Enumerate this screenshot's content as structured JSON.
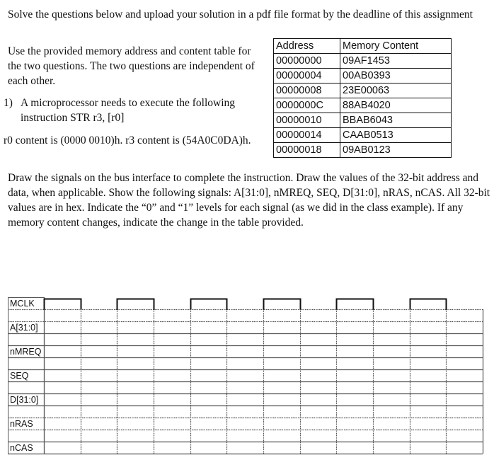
{
  "intro": "Solve the questions below and upload your solution in a pdf file format by the deadline of this assignment",
  "shared_note": "Use the provided memory address and content table for the two questions. The two questions are independent of each other.",
  "question1": {
    "number": "1)",
    "text": "A microprocessor needs to execute the following instruction STR  r3, [r0]"
  },
  "registers": "r0 content is (0000 0010)h. r3 content is (54A0C0DA)h.",
  "instructions": "Draw the signals on the bus interface to complete the instruction. Draw the values of the 32-bit address and data, when applicable. Show the following signals: A[31:0], nMREQ, SEQ, D[31:0], nRAS, nCAS. All 32-bit values are in hex. Indicate the “0” and “1” levels for each signal (as we did in the class example). If any memory content changes, indicate the change in the table provided.",
  "memory_table": {
    "headers": [
      "Address",
      "Memory Content"
    ],
    "rows": [
      [
        "00000000",
        "09AF1453"
      ],
      [
        "00000004",
        "00AB0393"
      ],
      [
        "00000008",
        "23E00063"
      ],
      [
        "0000000C",
        "88AB4020"
      ],
      [
        "00000010",
        "BBAB6043"
      ],
      [
        "00000014",
        "CAAB0513"
      ],
      [
        "00000018",
        "09AB0123"
      ]
    ]
  },
  "timing_diagram": {
    "signals": [
      "MCLK",
      "A[31:0]",
      "nMREQ",
      "SEQ",
      "D[31:0]",
      "nRAS",
      "nCAS"
    ],
    "columns": 12,
    "clock_pattern": [
      1,
      0,
      1,
      0,
      1,
      0,
      1,
      0,
      1,
      0,
      1,
      0
    ],
    "colors": {
      "line": "#555555",
      "clock": "#111111"
    }
  }
}
